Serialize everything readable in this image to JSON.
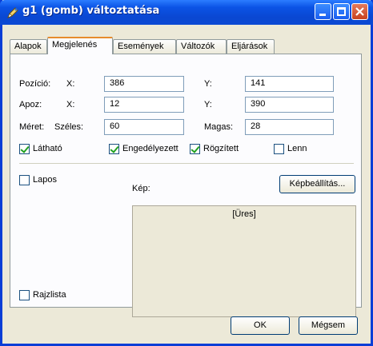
{
  "window": {
    "title": "g1 (gomb) változtatása",
    "icon": "pen-icon",
    "accent_color": "#0a3ed6"
  },
  "tabs": [
    {
      "label": "Alapok",
      "active": false
    },
    {
      "label": "Megjelenés",
      "active": true
    },
    {
      "label": "Események",
      "active": false
    },
    {
      "label": "Változók",
      "active": false
    },
    {
      "label": "Eljárások",
      "active": false
    }
  ],
  "position": {
    "label": "Pozíció:",
    "x_label": "X:",
    "x_value": "386",
    "y_label": "Y:",
    "y_value": "141"
  },
  "apoz": {
    "label": "Apoz:",
    "x_label": "X:",
    "x_value": "12",
    "y_label": "Y:",
    "y_value": "390"
  },
  "size": {
    "label": "Méret:",
    "width_label": "Széles:",
    "width_value": "60",
    "height_label": "Magas:",
    "height_value": "28"
  },
  "checks": {
    "lathato": {
      "label": "Látható",
      "checked": true
    },
    "engedelyezett": {
      "label": "Engedélyezett",
      "checked": true
    },
    "rogzitett": {
      "label": "Rögzített",
      "checked": true
    },
    "lenn": {
      "label": "Lenn",
      "checked": false
    },
    "lapos": {
      "label": "Lapos",
      "checked": false
    },
    "rajzlista": {
      "label": "Rajzlista",
      "checked": false
    }
  },
  "image": {
    "label": "Kép:",
    "settings_button": "Képbeállítás...",
    "empty_text": "[Üres]"
  },
  "footer": {
    "ok": "OK",
    "cancel": "Mégsem"
  }
}
